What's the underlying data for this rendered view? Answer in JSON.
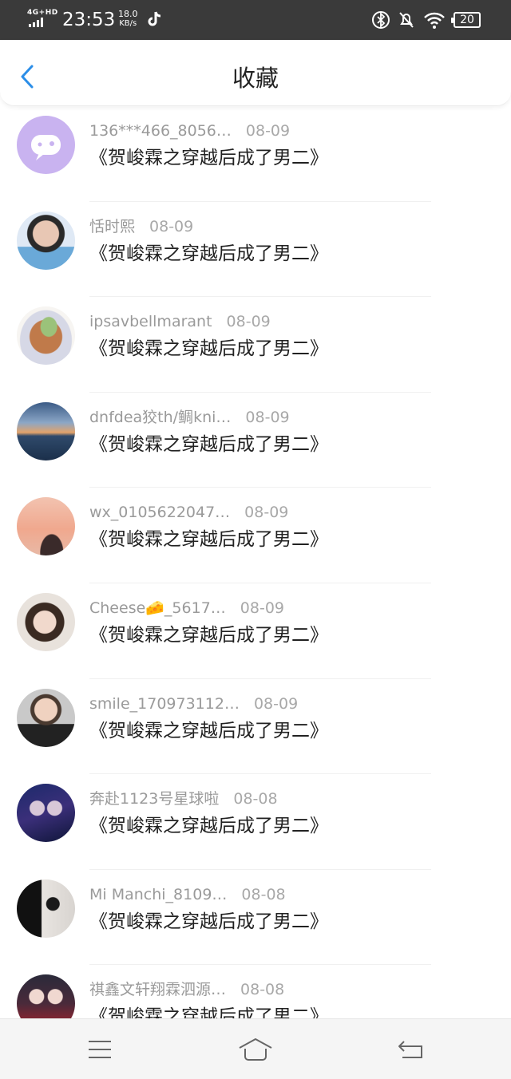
{
  "status_bar": {
    "network": "4G+HD",
    "time": "23:53",
    "speed_value": "18.0",
    "speed_unit": "KB/s",
    "battery": "20",
    "icons": [
      "signal-icon",
      "tiktok-icon",
      "bluetooth-icon",
      "mute-icon",
      "wifi-icon",
      "battery-icon"
    ]
  },
  "header": {
    "title": "收藏",
    "back_icon": "chevron-left-icon"
  },
  "favorites": [
    {
      "user": "136***466_8056…",
      "date": "08-09",
      "book": "《贺峻霖之穿越后成了男二》",
      "avatar": "avatar-emoji-purple"
    },
    {
      "user": "恬时熙",
      "date": "08-09",
      "book": "《贺峻霖之穿越后成了男二》",
      "avatar": "avatar-boy-blue"
    },
    {
      "user": "ipsavbellmarant",
      "date": "08-09",
      "book": "《贺峻霖之穿越后成了男二》",
      "avatar": "avatar-food"
    },
    {
      "user": "dnfdea狡th/鲷kni…",
      "date": "08-09",
      "book": "《贺峻霖之穿越后成了男二》",
      "avatar": "avatar-sunset-sea"
    },
    {
      "user": "wx_0105622047…",
      "date": "08-09",
      "book": "《贺峻霖之穿越后成了男二》",
      "avatar": "avatar-pink-sky"
    },
    {
      "user": "Cheese🧀_5617…",
      "date": "08-09",
      "book": "《贺峻霖之穿越后成了男二》",
      "avatar": "avatar-girl"
    },
    {
      "user": "smile_170973112…",
      "date": "08-09",
      "book": "《贺峻霖之穿越后成了男二》",
      "avatar": "avatar-kid"
    },
    {
      "user": "奔赴1123号星球啦",
      "date": "08-08",
      "book": "《贺峻霖之穿越后成了男二》",
      "avatar": "avatar-couple-dark"
    },
    {
      "user": "Mi Manchi_8109…",
      "date": "08-08",
      "book": "《贺峻霖之穿越后成了男二》",
      "avatar": "avatar-black-white"
    },
    {
      "user": "祺鑫文轩翔霖泗源…",
      "date": "08-08",
      "book": "《贺峻霖之穿越后成了男二》",
      "avatar": "avatar-couple-red"
    }
  ],
  "nav": {
    "icons": [
      "menu-icon",
      "home-icon",
      "back-icon"
    ]
  },
  "colors": {
    "accent": "#2b8ee8",
    "status_bar": "#3a3a3a",
    "meta_text": "#9a9a9a",
    "title_text": "#222222"
  }
}
